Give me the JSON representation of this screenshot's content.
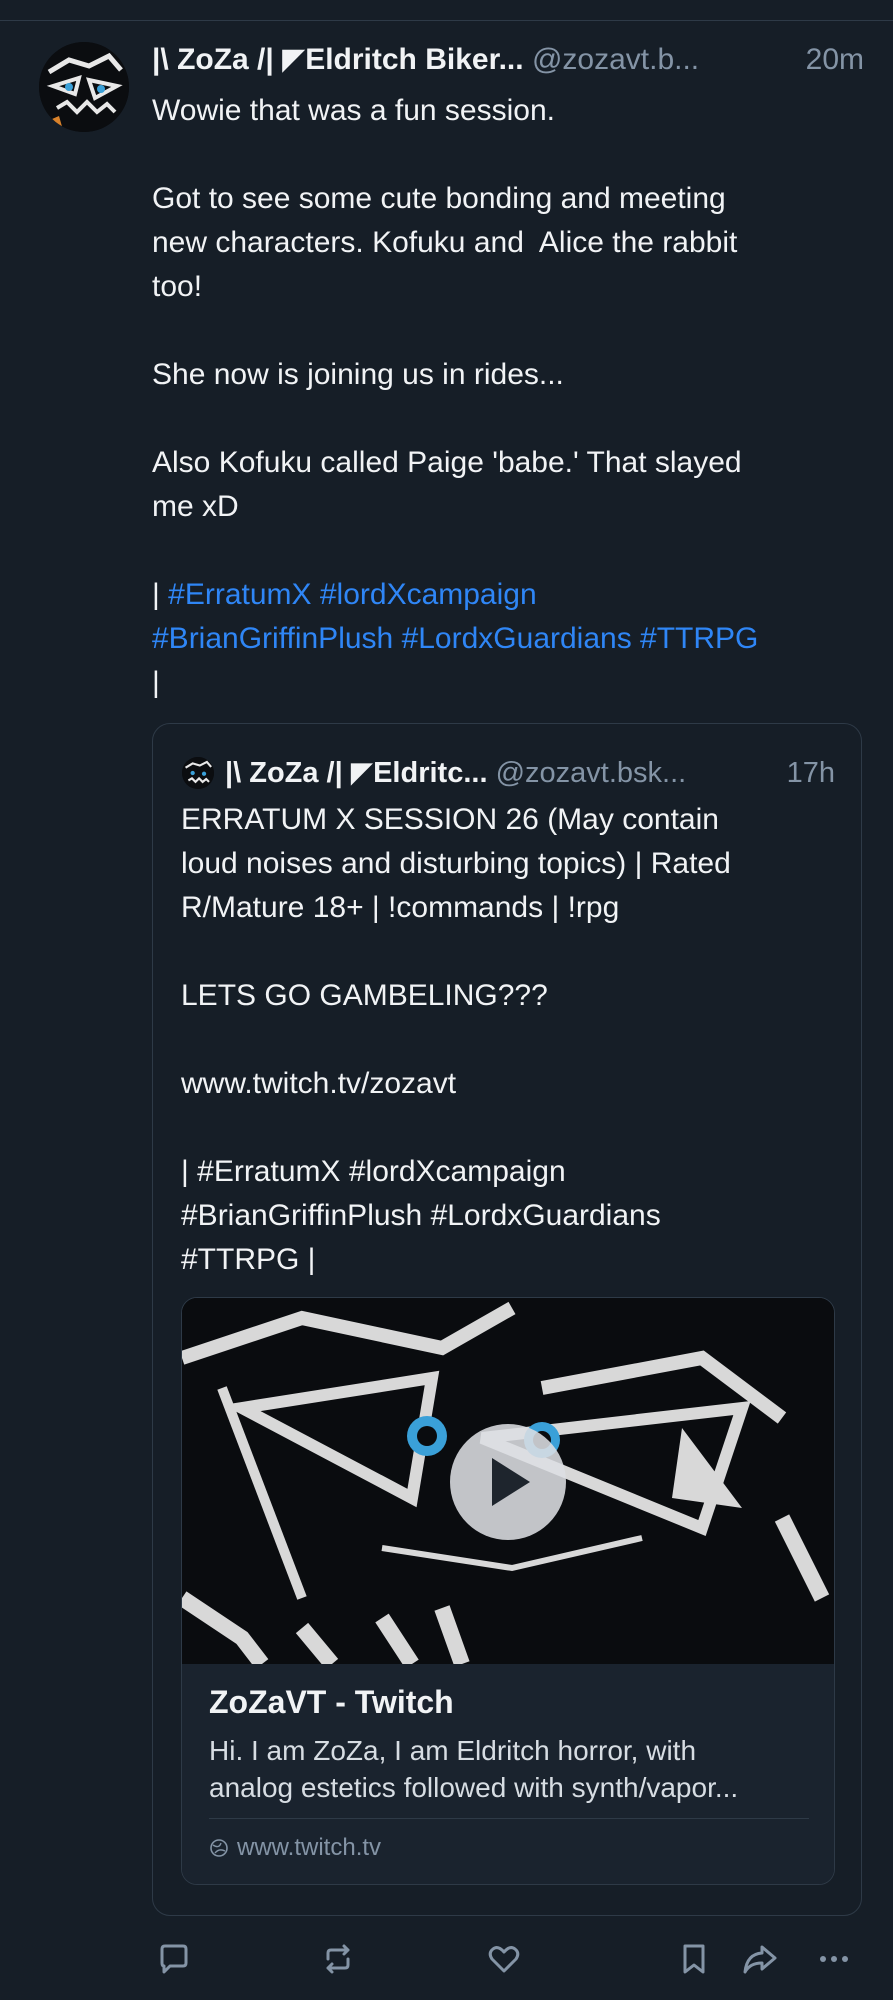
{
  "post": {
    "display_name": "|\\ ZoZa /| ◤Eldritch Biker...",
    "handle": "@zozavt.b...",
    "time": "20m",
    "text_lines": [
      "Wowie that was a fun session.",
      "",
      "Got to see some cute bonding and meeting",
      "new characters. Kofuku and  Alice the rabbit",
      "too!",
      "",
      "She now is joining us in rides...",
      "",
      "Also Kofuku called Paige 'babe.' That slayed",
      "me xD",
      ""
    ],
    "tags_line_prefix": "| ",
    "tags_line1": "#ErratumX #lordXcampaign",
    "tags_line2": "#BrianGriffinPlush #LordxGuardians #TTRPG",
    "tags_line_suffix": "|"
  },
  "quote": {
    "display_name": "|\\ ZoZa /| ◤Eldritc...",
    "handle": "@zozavt.bsk...",
    "time": "17h",
    "text": "ERRATUM X SESSION 26 (May contain\nloud noises and disturbing topics) | Rated\nR/Mature 18+ | !commands | !rpg\n\nLETS GO GAMBELING???\n\nwww.twitch.tv/zozavt\n\n| #ErratumX #lordXcampaign\n#BrianGriffinPlush #LordxGuardians\n#TTRPG |"
  },
  "embed": {
    "title": "ZoZaVT - Twitch",
    "desc_line1": "Hi. I am ZoZa, I am Eldritch horror, with",
    "desc_line2": "analog estetics followed with synth/vapor...",
    "domain": "www.twitch.tv"
  },
  "colors": {
    "background": "#161e27",
    "link": "#2f86f6",
    "muted": "#8494a6"
  },
  "icons": [
    "reply-icon",
    "repost-icon",
    "like-icon",
    "bookmark-icon",
    "share-icon",
    "more-icon",
    "play-icon",
    "globe-icon"
  ]
}
